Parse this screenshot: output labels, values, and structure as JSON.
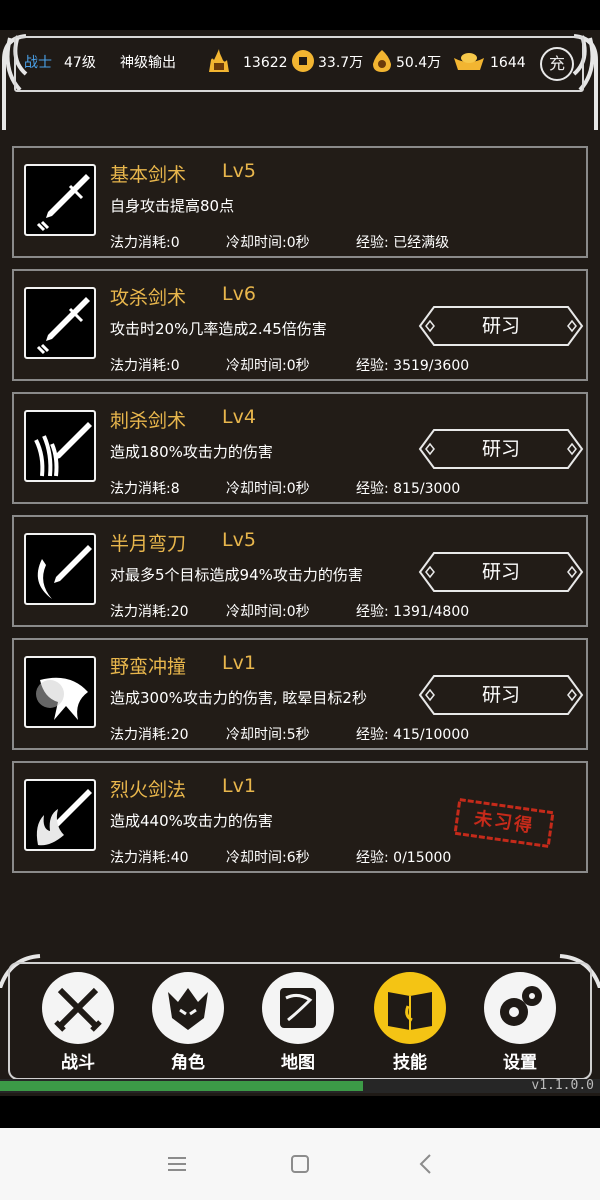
{
  "header": {
    "class_name": "战士",
    "level": "47级",
    "title": "神级输出",
    "combat_power": "13622",
    "coins": "33.7万",
    "gems": "50.4万",
    "gold": "1644",
    "recharge_label": "充",
    "colors": {
      "class": "#4aa0e8",
      "gold": "#e8b64c"
    }
  },
  "skills": [
    {
      "name": "基本剑术",
      "level": "Lv5",
      "desc": "自身攻击提高80点",
      "mana": "法力消耗:0",
      "cooldown": "冷却时间:0秒",
      "exp": "经验: 已经满级",
      "action": "",
      "icon": "sword-icon"
    },
    {
      "name": "攻杀剑术",
      "level": "Lv6",
      "desc": "攻击时20%几率造成2.45倍伤害",
      "mana": "法力消耗:0",
      "cooldown": "冷却时间:0秒",
      "exp": "经验: 3519/3600",
      "action": "研习",
      "icon": "sword-icon"
    },
    {
      "name": "刺杀剑术",
      "level": "Lv4",
      "desc": "造成180%攻击力的伤害",
      "mana": "法力消耗:8",
      "cooldown": "冷却时间:0秒",
      "exp": "经验: 815/3000",
      "action": "研习",
      "icon": "thrust-sword-icon"
    },
    {
      "name": "半月弯刀",
      "level": "Lv5",
      "desc": "对最多5个目标造成94%攻击力的伤害",
      "mana": "法力消耗:20",
      "cooldown": "冷却时间:0秒",
      "exp": "经验: 1391/4800",
      "action": "研习",
      "icon": "crescent-blade-icon"
    },
    {
      "name": "野蛮冲撞",
      "level": "Lv1",
      "desc": "造成300%攻击力的伤害, 眩晕目标2秒",
      "mana": "法力消耗:20",
      "cooldown": "冷却时间:5秒",
      "exp": "经验: 415/10000",
      "action": "研习",
      "icon": "charge-icon"
    },
    {
      "name": "烈火剑法",
      "level": "Lv1",
      "desc": "造成440%攻击力的伤害",
      "mana": "法力消耗:40",
      "cooldown": "冷却时间:6秒",
      "exp": "经验: 0/15000",
      "action": "",
      "stamp": "未习得",
      "icon": "fire-sword-icon"
    }
  ],
  "nav": [
    {
      "label": "战斗",
      "icon": "crossed-swords-icon",
      "active": false
    },
    {
      "label": "角色",
      "icon": "helmet-icon",
      "active": false
    },
    {
      "label": "地图",
      "icon": "map-scroll-icon",
      "active": false
    },
    {
      "label": "技能",
      "icon": "skill-book-icon",
      "active": true
    },
    {
      "label": "设置",
      "icon": "gears-icon",
      "active": false
    }
  ],
  "progress": 0.605,
  "version": "v1.1.0.0",
  "system_nav": [
    "menu-icon",
    "home-icon",
    "back-icon"
  ]
}
